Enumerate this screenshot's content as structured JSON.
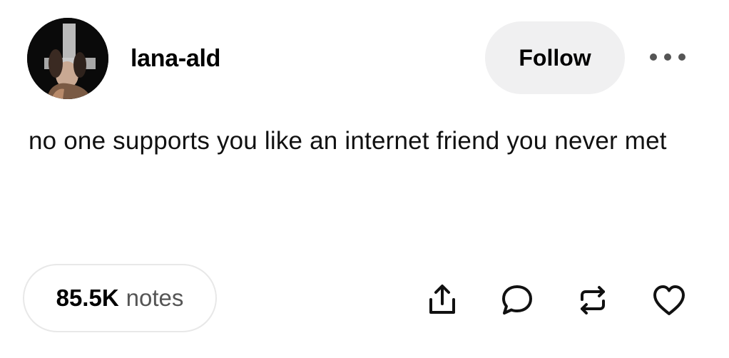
{
  "post": {
    "username": "lana-ald",
    "follow_label": "Follow",
    "text": "no one supports you like an internet friend you never met",
    "notes": {
      "count": "85.5K",
      "label": "notes"
    }
  },
  "icons": {
    "more": "more-horizontal-icon",
    "share": "share-icon",
    "reply": "reply-icon",
    "reblog": "reblog-icon",
    "like": "heart-icon"
  },
  "colors": {
    "follow_button_bg": "#f0f0f1",
    "notes_border": "#e8e8e8",
    "icon_stroke": "#111111"
  }
}
